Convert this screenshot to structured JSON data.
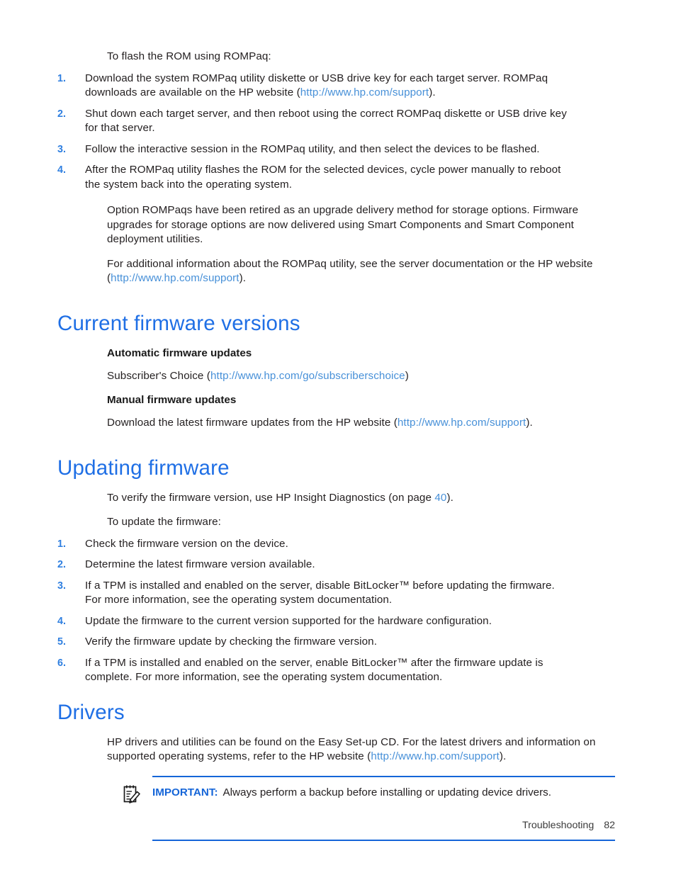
{
  "page": {
    "footer_section": "Troubleshooting",
    "footer_page": "82"
  },
  "intro": {
    "lead": "To flash the ROM using ROMPaq:",
    "steps": [
      {
        "num": "1.",
        "text_before": "Download the system ROMPaq utility diskette or USB drive key for each target server. ROMPaq downloads are available on the HP website (",
        "link": "http://www.hp.com/support",
        "text_after": ")."
      },
      {
        "num": "2.",
        "text_before": "Shut down each target server, and then reboot using the correct ROMPaq diskette or USB drive key for that server.",
        "link": "",
        "text_after": ""
      },
      {
        "num": "3.",
        "text_before": "Follow the interactive session in the ROMPaq utility, and then select the devices to be flashed.",
        "link": "",
        "text_after": ""
      },
      {
        "num": "4.",
        "text_before": "After the ROMPaq utility flashes the ROM for the selected devices, cycle power manually to reboot the system back into the operating system.",
        "link": "",
        "text_after": ""
      }
    ],
    "para_retired": "Option ROMPaqs have been retired as an upgrade delivery method for storage options. Firmware upgrades for storage options are now delivered using Smart Components and Smart Component deployment utilities.",
    "para_additional_before": "For additional information about the ROMPaq utility, see the server documentation or the HP website (",
    "para_additional_link": "http://www.hp.com/support",
    "para_additional_after": ")."
  },
  "current_firmware": {
    "heading": "Current firmware versions",
    "auto_subhead": "Automatic firmware updates",
    "auto_text_before": "Subscriber's Choice (",
    "auto_link": "http://www.hp.com/go/subscriberschoice",
    "auto_text_after": ")",
    "manual_subhead": "Manual firmware updates",
    "manual_text_before": "Download the latest firmware updates from the HP website (",
    "manual_link": "http://www.hp.com/support",
    "manual_text_after": ")."
  },
  "updating_firmware": {
    "heading": "Updating firmware",
    "verify_before": "To verify the firmware version, use HP Insight Diagnostics (on page ",
    "verify_pageref": "40",
    "verify_after": ").",
    "lead": "To update the firmware:",
    "steps": [
      {
        "num": "1.",
        "text": "Check the firmware version on the device."
      },
      {
        "num": "2.",
        "text": "Determine the latest firmware version available."
      },
      {
        "num": "3.",
        "text": "If a TPM is installed and enabled on the server, disable BitLocker™ before updating the firmware. For more information, see the operating system documentation."
      },
      {
        "num": "4.",
        "text": "Update the firmware to the current version supported for the hardware configuration."
      },
      {
        "num": "5.",
        "text": "Verify the firmware update by checking the firmware version."
      },
      {
        "num": "6.",
        "text": "If a TPM is installed and enabled on the server, enable BitLocker™ after the firmware update is complete. For more information, see the operating system documentation."
      }
    ]
  },
  "drivers": {
    "heading": "Drivers",
    "para_before": "HP drivers and utilities can be found on the Easy Set-up CD. For the latest drivers and information on supported operating systems, refer to the HP website (",
    "para_link": "http://www.hp.com/support",
    "para_after": ").",
    "note_label": "IMPORTANT:",
    "note_text": "Always perform a backup before installing or updating device drivers."
  },
  "colors": {
    "heading_blue": "#1f6fe5",
    "link_blue": "#4790d8",
    "list_number_blue": "#2f7fe0",
    "rule_blue": "#1565d8",
    "body_text": "#231f20"
  }
}
